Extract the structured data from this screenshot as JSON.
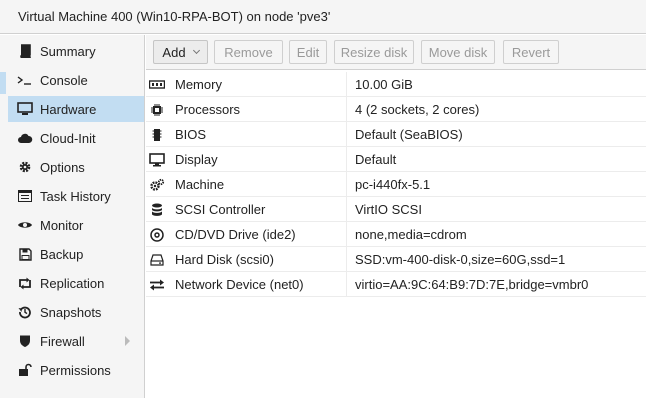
{
  "title": "Virtual Machine 400 (Win10-RPA-BOT) on node 'pve3'",
  "sidebar": {
    "items": [
      {
        "label": "Summary",
        "icon": "book-icon"
      },
      {
        "label": "Console",
        "icon": "terminal-icon"
      },
      {
        "label": "Hardware",
        "icon": "monitor-icon",
        "active": true
      },
      {
        "label": "Cloud-Init",
        "icon": "cloud-icon"
      },
      {
        "label": "Options",
        "icon": "gear-icon"
      },
      {
        "label": "Task History",
        "icon": "list-icon"
      },
      {
        "label": "Monitor",
        "icon": "eye-icon"
      },
      {
        "label": "Backup",
        "icon": "floppy-icon"
      },
      {
        "label": "Replication",
        "icon": "retweet-icon"
      },
      {
        "label": "Snapshots",
        "icon": "history-icon"
      },
      {
        "label": "Firewall",
        "icon": "shield-icon",
        "expandable": true
      },
      {
        "label": "Permissions",
        "icon": "unlock-icon"
      }
    ]
  },
  "toolbar": {
    "add_label": "Add",
    "remove_label": "Remove",
    "edit_label": "Edit",
    "resize_label": "Resize disk",
    "move_label": "Move disk",
    "revert_label": "Revert"
  },
  "hardware": [
    {
      "name": "Memory",
      "value": "10.00 GiB",
      "icon": "memory-icon"
    },
    {
      "name": "Processors",
      "value": "4 (2 sockets, 2 cores)",
      "icon": "cpu-icon"
    },
    {
      "name": "BIOS",
      "value": "Default (SeaBIOS)",
      "icon": "microchip-icon"
    },
    {
      "name": "Display",
      "value": "Default",
      "icon": "desktop-icon"
    },
    {
      "name": "Machine",
      "value": "pc-i440fx-5.1",
      "icon": "cogs-icon"
    },
    {
      "name": "SCSI Controller",
      "value": "VirtIO SCSI",
      "icon": "database-icon"
    },
    {
      "name": "CD/DVD Drive (ide2)",
      "value": "none,media=cdrom",
      "icon": "cdrom-icon"
    },
    {
      "name": "Hard Disk (scsi0)",
      "value": "SSD:vm-400-disk-0,size=60G,ssd=1",
      "icon": "hdd-icon"
    },
    {
      "name": "Network Device (net0)",
      "value": "virtio=AA:9C:64:B9:7D:7E,bridge=vmbr0",
      "icon": "exchange-icon"
    }
  ],
  "colors": {
    "selected": "#c2ddf2",
    "panel": "#f5f5f5",
    "border": "#d0d0d0"
  }
}
